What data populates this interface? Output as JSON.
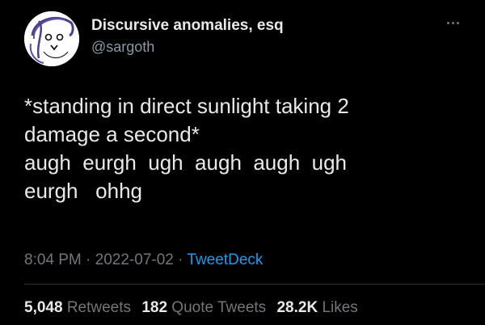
{
  "user": {
    "display_name": "Discursive anomalies, esq",
    "handle": "@sargoth"
  },
  "tweet": {
    "text": "*standing in direct sunlight taking 2\ndamage a second*\naugh  eurgh  ugh  augh  augh  ugh\neurgh   ohhg"
  },
  "meta": {
    "time": "8:04 PM",
    "separator": "·",
    "date": "2022-07-02",
    "source": "TweetDeck"
  },
  "stats": {
    "retweets_count": "5,048",
    "retweets_label": "Retweets",
    "quotes_count": "182",
    "quotes_label": "Quote Tweets",
    "likes_count": "28.2K",
    "likes_label": "Likes"
  },
  "icons": {
    "more": "more-options-icon",
    "avatar": "avatar-doodle-face"
  },
  "colors": {
    "background": "#000000",
    "primary_text": "#e7e9ea",
    "secondary_text": "#71767b",
    "link": "#1d9bf0"
  }
}
